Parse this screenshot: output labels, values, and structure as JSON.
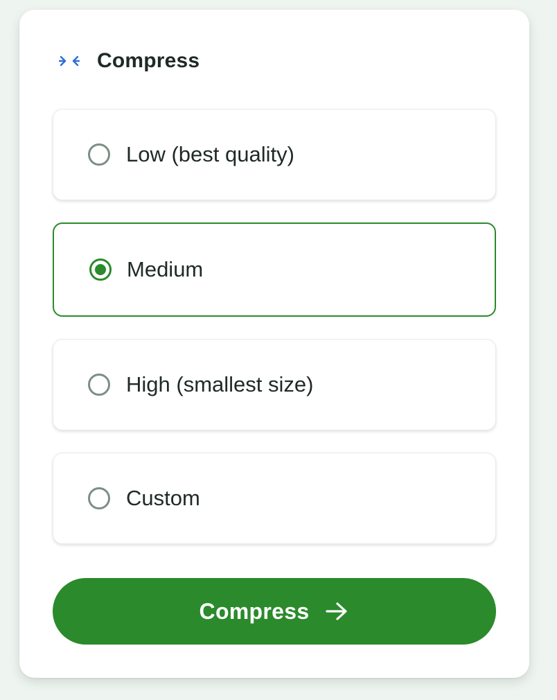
{
  "panel": {
    "title": "Compress",
    "icon": "compress-icon",
    "icon_color": "#2f6fd6"
  },
  "options": [
    {
      "label": "Low (best quality)",
      "selected": false
    },
    {
      "label": "Medium",
      "selected": true
    },
    {
      "label": "High (smallest size)",
      "selected": false
    },
    {
      "label": "Custom",
      "selected": false
    }
  ],
  "action": {
    "label": "Compress",
    "icon": "arrow-right-icon"
  },
  "colors": {
    "accent": "#2b8a2b",
    "radio_unselected": "#7b8f84",
    "text": "#1f2a24",
    "background": "#eef5f0"
  }
}
